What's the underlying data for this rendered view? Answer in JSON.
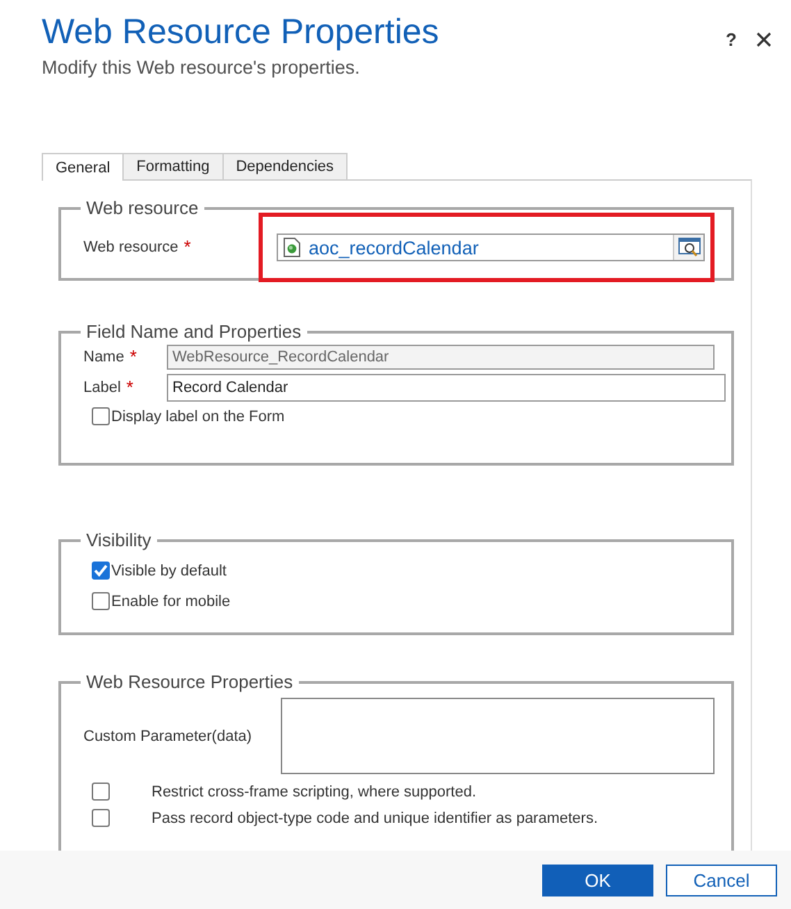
{
  "dialog": {
    "title": "Web Resource Properties",
    "subtitle": "Modify this Web resource's properties.",
    "help": "?"
  },
  "tabs": [
    {
      "label": "General",
      "selected": true
    },
    {
      "label": "Formatting",
      "selected": false
    },
    {
      "label": "Dependencies",
      "selected": false
    }
  ],
  "sections": [
    {
      "kind": "lookup",
      "legend": "Web resource",
      "label": "Web resource",
      "required_mark": "*",
      "value": "aoc_recordCalendar",
      "highlighted": true
    },
    {
      "kind": "fields",
      "legend": "Field Name and Properties",
      "fields": [
        {
          "label": "Name",
          "required_mark": "*",
          "value": "WebResource_RecordCalendar",
          "disabled": true
        },
        {
          "label": "Label",
          "required_mark": "*",
          "value": "Record Calendar",
          "disabled": false
        }
      ],
      "checkboxes": [
        {
          "label": "Display label on the Form",
          "checked": false
        }
      ]
    },
    {
      "kind": "checks",
      "legend": "Visibility",
      "checkboxes": [
        {
          "label": "Visible by default",
          "checked": true
        },
        {
          "label": "Enable for mobile",
          "checked": false
        }
      ]
    },
    {
      "kind": "params",
      "legend": "Web Resource Properties",
      "label": "Custom Parameter(data)",
      "checkboxes": [
        {
          "label": "Restrict cross-frame scripting, where supported.",
          "checked": false
        },
        {
          "label": "Pass record object-type code and unique identifier as parameters.",
          "checked": false
        }
      ]
    }
  ],
  "buttons": [
    {
      "label": "OK",
      "kind": "primary"
    },
    {
      "label": "Cancel",
      "kind": "secondary"
    }
  ]
}
